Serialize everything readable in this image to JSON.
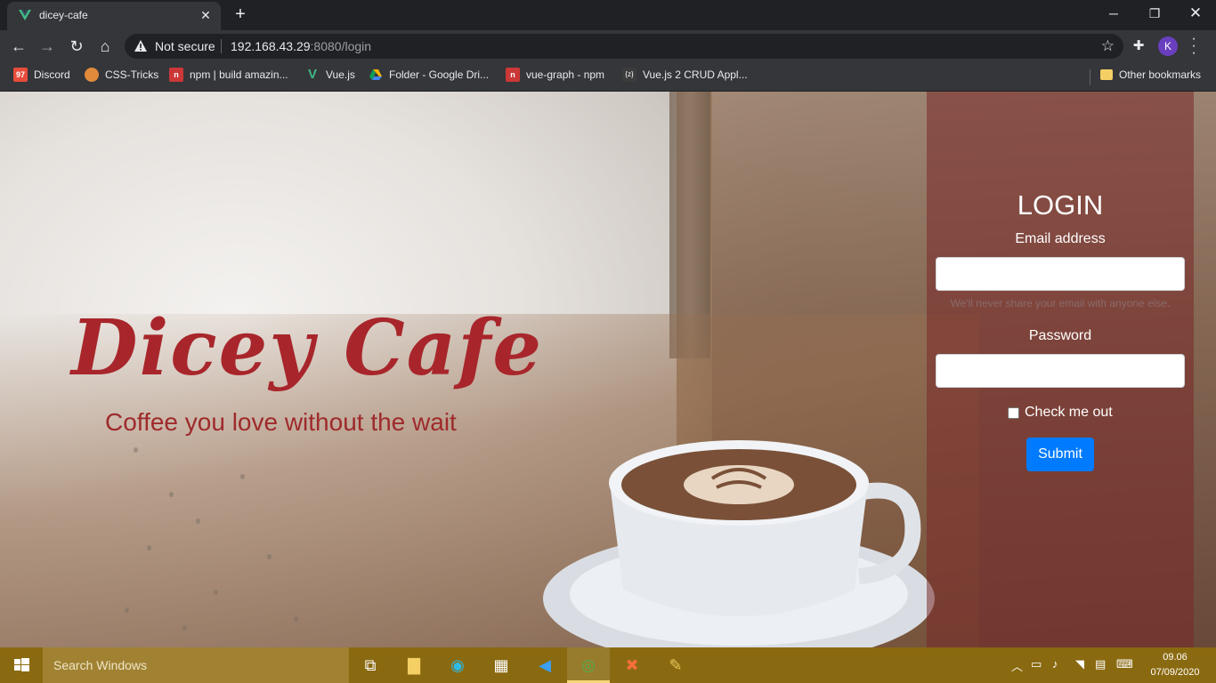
{
  "browser": {
    "tab_title": "dicey-cafe",
    "tab_close": "✕",
    "new_tab": "+",
    "window_min": "─",
    "window_max": "❐",
    "window_close": "✕",
    "security_label": "Not secure",
    "url_host": "192.168.43.29",
    "url_path": ":8080/login",
    "profile_initial": "K",
    "icons": [
      "back-icon",
      "forward-icon",
      "reload-icon",
      "home-icon",
      "warning-icon",
      "star-icon",
      "extensions-icon",
      "menu-icon"
    ]
  },
  "bookmarks": {
    "items": [
      {
        "label": "Discord",
        "icon": "discord-icon",
        "badge": "97",
        "color": "#e74c3c"
      },
      {
        "label": "CSS-Tricks",
        "icon": "css-tricks-icon",
        "badge": "",
        "color": "#e08a3c"
      },
      {
        "label": "npm | build amazin...",
        "icon": "npm-icon",
        "badge": "n",
        "color": "#cb3837"
      },
      {
        "label": "Vue.js",
        "icon": "vue-icon",
        "badge": "",
        "color": "#41b883"
      },
      {
        "label": "Folder - Google Dri...",
        "icon": "google-drive-icon",
        "badge": "",
        "color": "#f4b400"
      },
      {
        "label": "vue-graph - npm",
        "icon": "npm-icon",
        "badge": "n",
        "color": "#cb3837"
      },
      {
        "label": "Vue.js 2 CRUD Appl...",
        "icon": "code-icon",
        "badge": "{z}",
        "color": "#555555"
      }
    ],
    "other": "Other bookmarks"
  },
  "hero": {
    "title": "Dicey Cafe",
    "tagline": "Coffee you love without the wait"
  },
  "login": {
    "heading": "LOGIN",
    "email_label": "Email address",
    "email_value": "",
    "email_help": "We'll never share your email with anyone else.",
    "password_label": "Password",
    "password_value": "",
    "remember_label": "Check me out",
    "remember_checked": false,
    "submit_label": "Submit",
    "submit_color": "#007bff"
  },
  "taskbar": {
    "search_placeholder": "Search Windows",
    "apps": [
      "task-view-icon",
      "file-explorer-icon",
      "edge-icon",
      "store-icon",
      "vscode-icon",
      "chrome-icon",
      "xampp-icon",
      "paint-icon"
    ],
    "time": "09.06",
    "date": "07/09/2020"
  }
}
